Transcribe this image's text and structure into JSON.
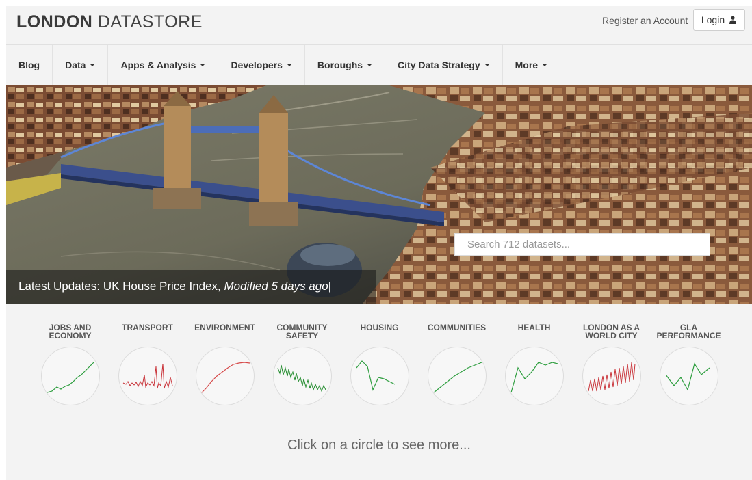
{
  "header": {
    "logo_bold": "LONDON",
    "logo_light": "DATASTORE",
    "register_label": "Register an Account",
    "login_label": "Login"
  },
  "nav": {
    "items": [
      {
        "label": "Blog",
        "dropdown": false
      },
      {
        "label": "Data",
        "dropdown": true
      },
      {
        "label": "Apps & Analysis",
        "dropdown": true
      },
      {
        "label": "Developers",
        "dropdown": true
      },
      {
        "label": "Boroughs",
        "dropdown": true
      },
      {
        "label": "City Data Strategy",
        "dropdown": true
      },
      {
        "label": "More",
        "dropdown": true
      }
    ]
  },
  "hero": {
    "search_placeholder": "Search 712 datasets...",
    "updates_prefix": "Latest Updates: ",
    "updates_item": "UK House Price Index, ",
    "updates_modified": "Modified 5 days ago"
  },
  "categories": [
    {
      "label": "JOBS AND ECONOMY",
      "color": "#2e9e3f"
    },
    {
      "label": "TRANSPORT",
      "color": "#c9343a"
    },
    {
      "label": "ENVIRONMENT",
      "color": "#d64a4a"
    },
    {
      "label": "COMMUNITY SAFETY",
      "color": "#1f8a2a"
    },
    {
      "label": "HOUSING",
      "color": "#2e9e3f"
    },
    {
      "label": "COMMUNITIES",
      "color": "#2e9e3f"
    },
    {
      "label": "HEALTH",
      "color": "#2e9e3f"
    },
    {
      "label": "LONDON AS A WORLD CITY",
      "color": "#c9343a"
    },
    {
      "label": "GLA PERFORMANCE",
      "color": "#2e9e3f"
    }
  ],
  "footer_prompt": "Click on a circle to see more...",
  "icons": {
    "login": "user-icon"
  }
}
